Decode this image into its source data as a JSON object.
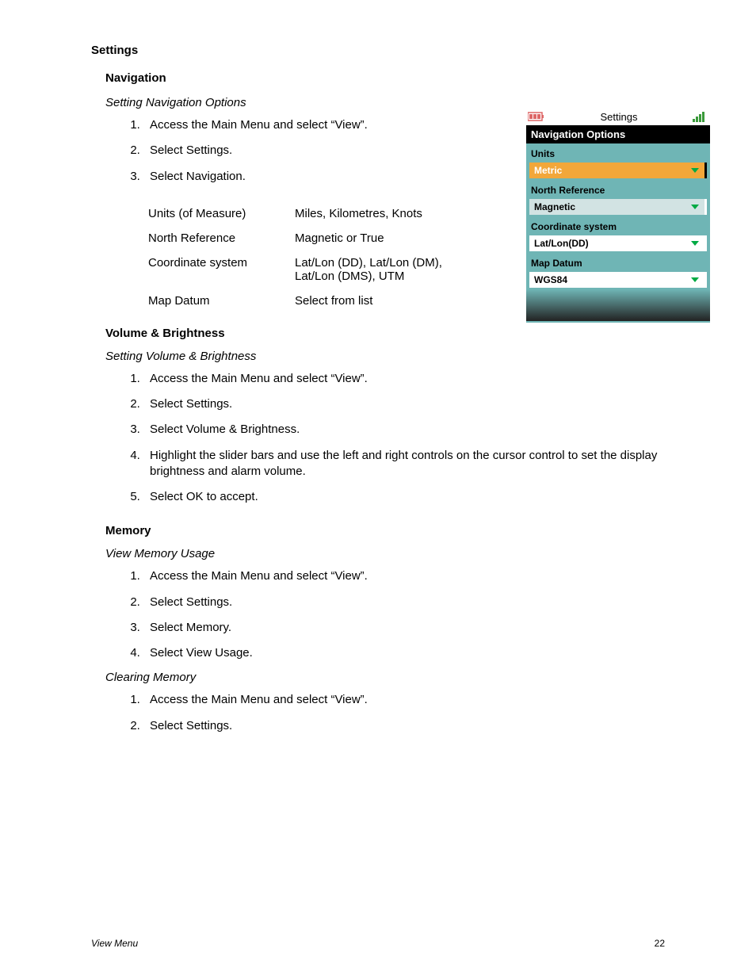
{
  "page_title": "Settings",
  "sections": {
    "navigation": {
      "heading": "Navigation",
      "subheading": "Setting Navigation Options",
      "steps": [
        "Access the Main Menu and select “View”.",
        "Select Settings.",
        "Select Navigation."
      ],
      "options": [
        {
          "key": "Units (of Measure)",
          "value": "Miles, Kilometres, Knots"
        },
        {
          "key": "North Reference",
          "value": "Magnetic or True"
        },
        {
          "key": "Coordinate system",
          "value": "Lat/Lon (DD), Lat/Lon (DM), Lat/Lon (DMS), UTM"
        },
        {
          "key": "Map Datum",
          "value": "Select from list"
        }
      ]
    },
    "volbright": {
      "heading": "Volume & Brightness",
      "subheading": "Setting Volume & Brightness",
      "steps": [
        "Access the Main Menu and select “View”.",
        "Select Settings.",
        "Select Volume & Brightness.",
        "Highlight the slider bars and use the left and right controls on the cursor control to set the display brightness and alarm volume.",
        "Select OK to accept."
      ]
    },
    "memory": {
      "heading": "Memory",
      "view_usage": {
        "subheading": "View Memory Usage",
        "steps": [
          "Access the Main Menu and select “View”.",
          "Select Settings.",
          "Select Memory.",
          "Select View Usage."
        ]
      },
      "clearing": {
        "subheading": "Clearing Memory",
        "steps": [
          "Access the Main Menu and select “View”.",
          "Select Settings."
        ]
      }
    }
  },
  "device": {
    "status_title": "Settings",
    "header": "Navigation Options",
    "groups": [
      {
        "label": "Units",
        "value": "Metric",
        "style": "units"
      },
      {
        "label": "North Reference",
        "value": "Magnetic",
        "style": "gray"
      },
      {
        "label": "Coordinate system",
        "value": "Lat/Lon(DD)",
        "style": "white"
      },
      {
        "label": "Map Datum",
        "value": "WGS84",
        "style": "white"
      }
    ]
  },
  "footer": {
    "left": "View Menu",
    "right": "22"
  }
}
